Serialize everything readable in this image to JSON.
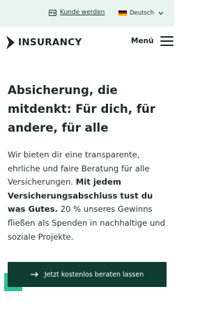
{
  "topbar": {
    "customer_link": "Kunde werden",
    "language": "Deutsch"
  },
  "navbar": {
    "brand": "INSURANCY",
    "menu_label": "Menü"
  },
  "hero": {
    "headline": "Absicherung, die mitdenkt: Für dich, für andere, für alle",
    "paragraph_intro": "Wir bieten dir eine transparente, ehrliche und faire Beratung für alle Versicherungen.",
    "paragraph_bold": "Mit jedem Versicherungsabschluss tust du was Gutes.",
    "paragraph_outro": "20 % unseres Gewinns fließen als Spenden in nachhaltige und soziale Projekte.",
    "cta_label": "Jetzt kostenlos beraten lassen"
  },
  "colors": {
    "topbar_bg": "#e9f3f0",
    "cta_bg": "#0f3d34",
    "accent": "#2fbf98"
  }
}
